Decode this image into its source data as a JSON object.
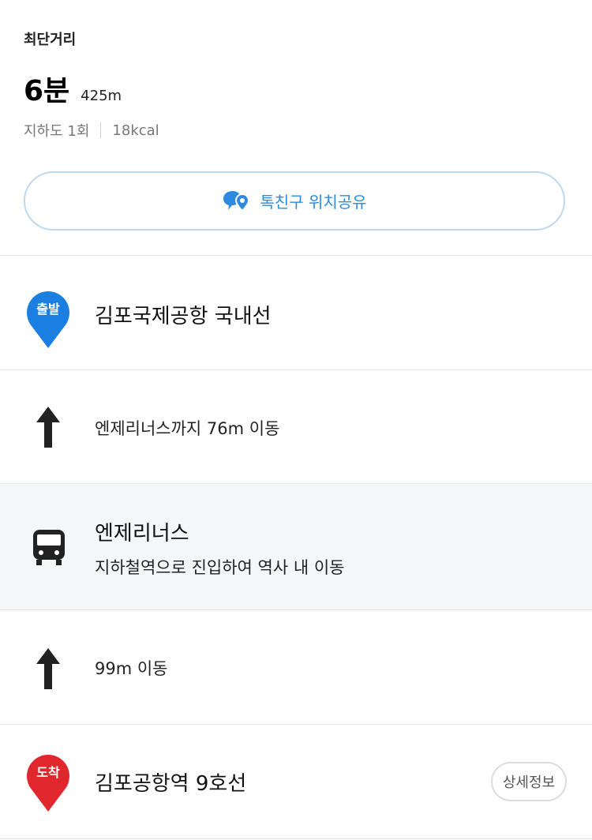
{
  "summary": {
    "route_type": "최단거리",
    "time": "6분",
    "distance": "425m",
    "underpass": "지하도 1회",
    "calories": "18kcal",
    "share_label": "톡친구 위치공유"
  },
  "steps": [
    {
      "kind": "start",
      "badge": "출발",
      "title": "김포국제공항 국내선",
      "color": "#1a7fe0"
    },
    {
      "kind": "walk",
      "text": "엔제리너스까지 76m 이동"
    },
    {
      "kind": "station",
      "title": "엔제리너스",
      "subtitle": "지하철역으로 진입하여 역사 내 이동"
    },
    {
      "kind": "walk",
      "text": "99m 이동"
    },
    {
      "kind": "end",
      "badge": "도착",
      "title": "김포공항역 9호선",
      "detail_label": "상세정보",
      "color": "#e0272e"
    }
  ],
  "colors": {
    "accent": "#2d8ae0",
    "start_pin": "#1a7fe0",
    "end_pin": "#e0272e"
  }
}
